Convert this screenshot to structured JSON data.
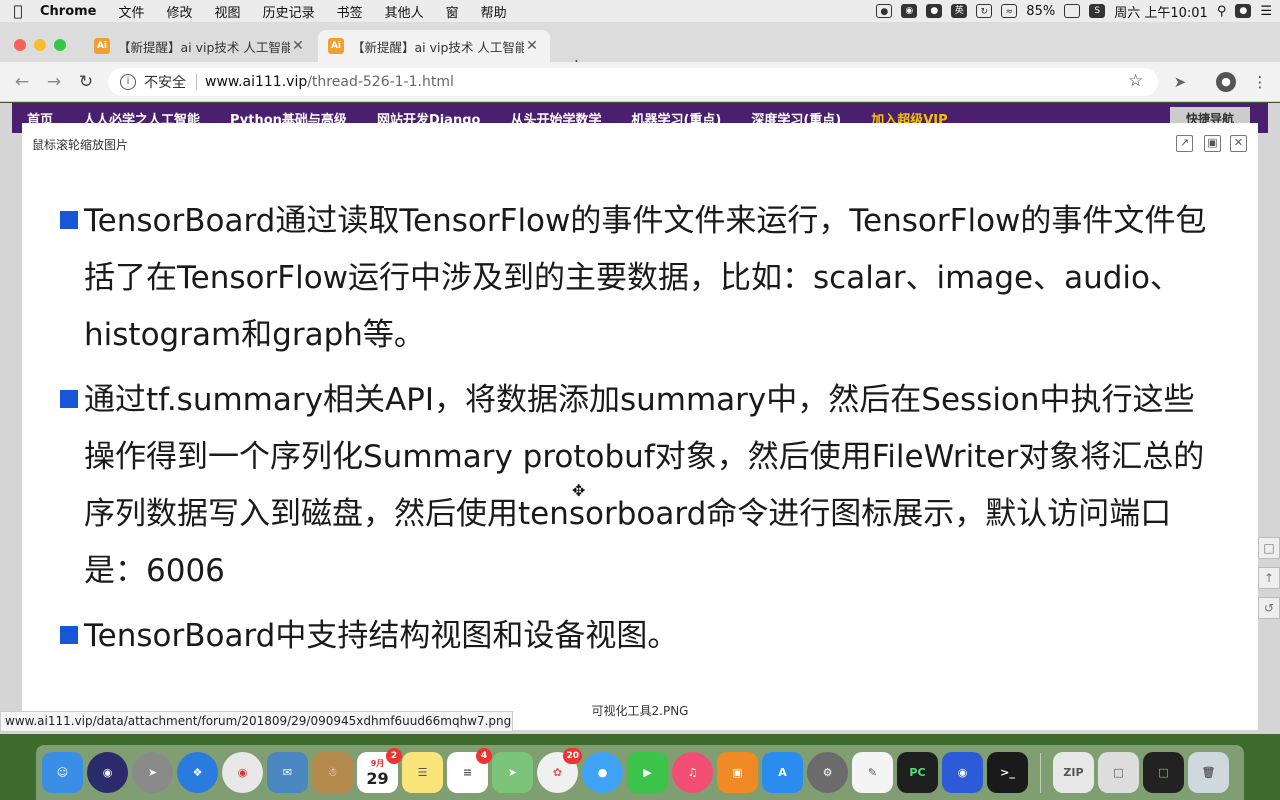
{
  "menubar": {
    "app": "Chrome",
    "items": [
      "文件",
      "修改",
      "视图",
      "历史记录",
      "书签",
      "其他人",
      "窗",
      "帮助"
    ],
    "ime": "英",
    "battery": "85%",
    "clock": "周六 上午10:01"
  },
  "tabs": [
    {
      "favicon": "Ai",
      "title": "【新提醒】ai vip技术 人工智能 |"
    },
    {
      "favicon": "Ai",
      "title": "【新提醒】ai vip技术 人工智能 |"
    }
  ],
  "toolbar": {
    "security_label": "不安全",
    "url_host": "www.ai111.vip",
    "url_path": "/thread-526-1-1.html"
  },
  "site_nav": {
    "links": [
      "首页",
      "人人必学之人工智能",
      "Python基础与高级",
      "网站开发Django",
      "从头开始学数学",
      "机器学习(重点)",
      "深度学习(重点)"
    ],
    "vip_link": "加入超级VIP",
    "quick_nav": "快捷导航"
  },
  "lightbox": {
    "hint": "鼠标滚轮缩放图片",
    "bullets": [
      "TensorBoard通过读取TensorFlow的事件文件来运行，TensorFlow的事件文件包括了在TensorFlow运行中涉及到的主要数据，比如：scalar、image、audio、histogram和graph等。",
      "通过tf.summary相关API，将数据添加summary中，然后在Session中执行这些操作得到一个序列化Summary protobuf对象，然后使用FileWriter对象将汇总的序列数据写入到磁盘，然后使用tensorboard命令进行图标展示，默认访问端口是：6006",
      "TensorBoard中支持结构视图和设备视图。"
    ],
    "caption": "可视化工具2.PNG"
  },
  "status_bar": "www.ai111.vip/data/attachment/forum/201809/29/090945xdhmf6uud66mqhw7.png",
  "dock": {
    "calendar_day": "29",
    "calendar_month": "9月",
    "badges": {
      "calendar": "2",
      "reminders": "4",
      "photos": "20"
    }
  },
  "colors": {
    "accent_bullet": "#1756d6",
    "site_nav_bg": "#4b1f6f",
    "vip": "#f6c200"
  }
}
